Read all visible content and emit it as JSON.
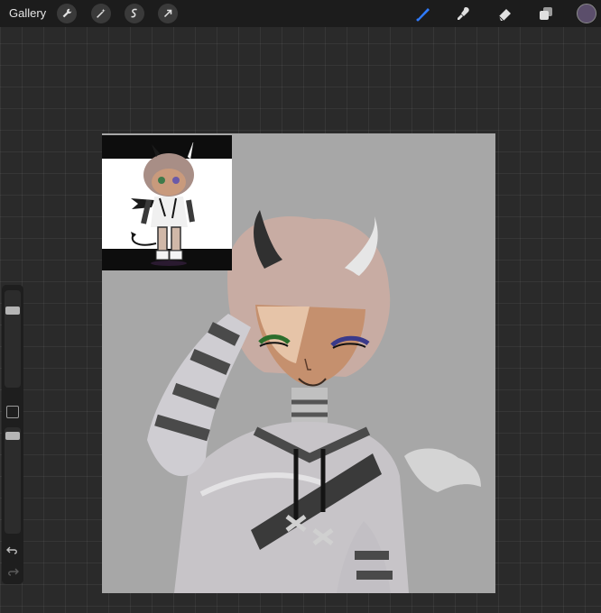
{
  "app": {
    "gallery_label": "Gallery"
  },
  "toolbar_left": {
    "icons": [
      "wrench-icon",
      "magic-wand-icon",
      "selection-icon",
      "transform-arrow-icon"
    ]
  },
  "toolbar_right": {
    "icons": [
      "brush-icon",
      "smudge-icon",
      "eraser-icon",
      "layers-icon"
    ],
    "active_tool": "brush",
    "active_color": "#5b4e6b",
    "brush_color": "#2f7bff"
  },
  "sidebar": {
    "brush_size_level": 0.12,
    "opacity_level": 0.05,
    "icons": [
      "modify-square-icon",
      "undo-icon",
      "redo-icon"
    ]
  },
  "canvas": {
    "background": "#a7a7a7"
  }
}
